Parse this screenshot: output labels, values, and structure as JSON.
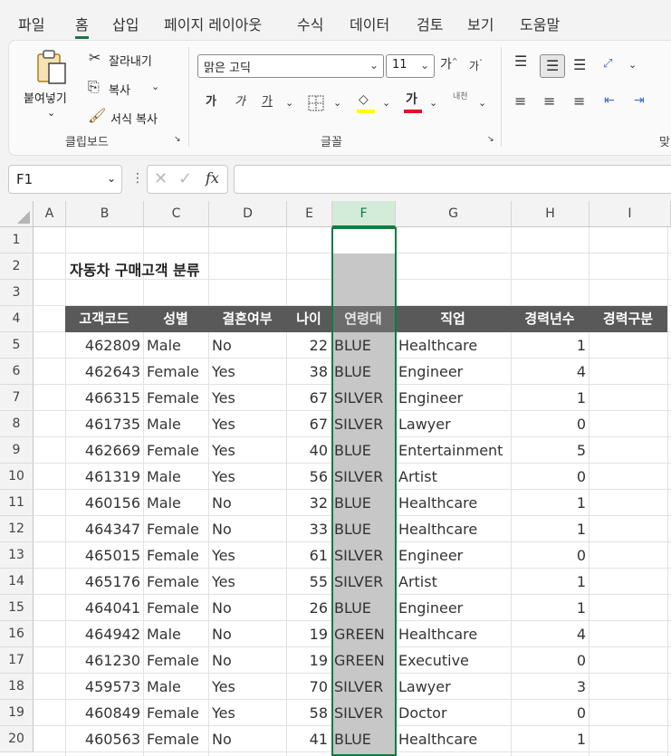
{
  "menu": [
    "파일",
    "홈",
    "삽입",
    "페이지 레이아웃",
    "수식",
    "데이터",
    "검토",
    "보기",
    "도움말"
  ],
  "ribbon": {
    "clipboard": {
      "paste": "붙여넣기",
      "cut": "잘라내기",
      "copy": "복사",
      "format_painter": "서식 복사",
      "group_label": "클립보드"
    },
    "font": {
      "name": "맑은 고딕",
      "size": "11",
      "bold": "가",
      "italic": "가",
      "underline": "가",
      "font_color": "가",
      "phonetic": "내천",
      "grow": "가",
      "shrink": "가",
      "group_label": "글꼴"
    },
    "alignment": {
      "group_label_partial": "맞"
    }
  },
  "formula_bar": {
    "name_box": "F1",
    "fx": "fx",
    "value": ""
  },
  "columns": [
    "A",
    "B",
    "C",
    "D",
    "E",
    "F",
    "G",
    "H",
    "I"
  ],
  "rows": [
    "1",
    "2",
    "3",
    "4",
    "5",
    "6",
    "7",
    "8",
    "9",
    "10",
    "11",
    "12",
    "13",
    "14",
    "15",
    "16",
    "17",
    "18",
    "19",
    "20"
  ],
  "sheet": {
    "title": "자동차 구매고객 분류",
    "headers": [
      "고객코드",
      "성별",
      "결혼여부",
      "나이",
      "연령대",
      "직업",
      "경력년수",
      "경력구분"
    ],
    "records": [
      [
        "462809",
        "Male",
        "No",
        "22",
        "BLUE",
        "Healthcare",
        "1"
      ],
      [
        "462643",
        "Female",
        "Yes",
        "38",
        "BLUE",
        "Engineer",
        "4"
      ],
      [
        "466315",
        "Female",
        "Yes",
        "67",
        "SILVER",
        "Engineer",
        "1"
      ],
      [
        "461735",
        "Male",
        "Yes",
        "67",
        "SILVER",
        "Lawyer",
        "0"
      ],
      [
        "462669",
        "Female",
        "Yes",
        "40",
        "BLUE",
        "Entertainment",
        "5"
      ],
      [
        "461319",
        "Male",
        "Yes",
        "56",
        "SILVER",
        "Artist",
        "0"
      ],
      [
        "460156",
        "Male",
        "No",
        "32",
        "BLUE",
        "Healthcare",
        "1"
      ],
      [
        "464347",
        "Female",
        "No",
        "33",
        "BLUE",
        "Healthcare",
        "1"
      ],
      [
        "465015",
        "Female",
        "Yes",
        "61",
        "SILVER",
        "Engineer",
        "0"
      ],
      [
        "465176",
        "Female",
        "Yes",
        "55",
        "SILVER",
        "Artist",
        "1"
      ],
      [
        "464041",
        "Female",
        "No",
        "26",
        "BLUE",
        "Engineer",
        "1"
      ],
      [
        "464942",
        "Male",
        "No",
        "19",
        "GREEN",
        "Healthcare",
        "4"
      ],
      [
        "461230",
        "Female",
        "No",
        "19",
        "GREEN",
        "Executive",
        "0"
      ],
      [
        "459573",
        "Male",
        "Yes",
        "70",
        "SILVER",
        "Lawyer",
        "3"
      ],
      [
        "460849",
        "Female",
        "Yes",
        "58",
        "SILVER",
        "Doctor",
        "0"
      ],
      [
        "460563",
        "Female",
        "No",
        "41",
        "BLUE",
        "Healthcare",
        "1"
      ]
    ]
  },
  "colors": {
    "accent": "#107c41",
    "header_fill": "#595959",
    "selected_column_fill": "#c7c7c7"
  }
}
